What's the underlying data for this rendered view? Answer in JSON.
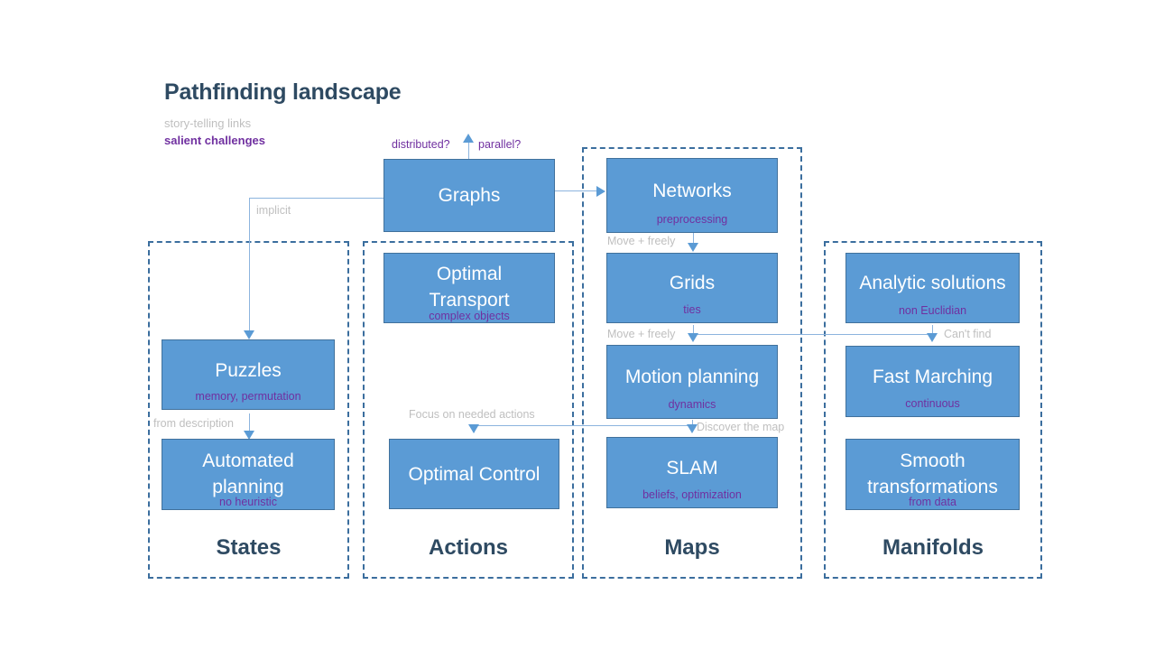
{
  "header": {
    "title": "Pathfinding landscape",
    "legend": [
      {
        "text": "story-telling links",
        "color": "#BFBFBF"
      },
      {
        "text": "salient challenges",
        "color": "#7030A0"
      }
    ]
  },
  "groups": [
    {
      "key": "states",
      "label": "States"
    },
    {
      "key": "actions",
      "label": "Actions"
    },
    {
      "key": "maps",
      "label": "Maps"
    },
    {
      "key": "manifolds",
      "label": "Manifolds"
    }
  ],
  "nodes": {
    "graphs": {
      "title": "Graphs",
      "sub": ""
    },
    "puzzles": {
      "title": "Puzzles",
      "sub": "memory, permutation"
    },
    "automated_planning": {
      "title": "Automated\nplanning",
      "sub": "no heuristic"
    },
    "optimal_transport": {
      "title": "Optimal\nTransport",
      "sub": "complex objects"
    },
    "optimal_control": {
      "title": "Optimal Control",
      "sub": ""
    },
    "networks": {
      "title": "Networks",
      "sub": "preprocessing"
    },
    "grids": {
      "title": "Grids",
      "sub": "ties"
    },
    "motion_planning": {
      "title": "Motion planning",
      "sub": "dynamics"
    },
    "slam": {
      "title": "SLAM",
      "sub": "beliefs, optimization"
    },
    "analytic_solutions": {
      "title": "Analytic solutions",
      "sub": "non Euclidian"
    },
    "fast_marching": {
      "title": "Fast Marching",
      "sub": "continuous"
    },
    "smooth_transformations": {
      "title": "Smooth\ntransformations",
      "sub": "from data"
    }
  },
  "edge_labels": {
    "distributed": "distributed?",
    "parallel": "parallel?",
    "implicit": "implicit",
    "from_description": "from description",
    "move_freely_1": "Move + freely",
    "move_freely_2": "Move + freely",
    "cant_find": "Can't find",
    "discover_the_map": "Discover the map",
    "focus_on_needed_actions": "Focus on needed actions"
  },
  "colors": {
    "node_fill": "#5B9BD5",
    "node_border": "#41719C",
    "group_border": "#3B6E9E",
    "title_text": "#2E4A62",
    "subtitle_text": "#7030A0",
    "link_gray": "#BFBFBF",
    "connector": "#8CB4DE"
  }
}
